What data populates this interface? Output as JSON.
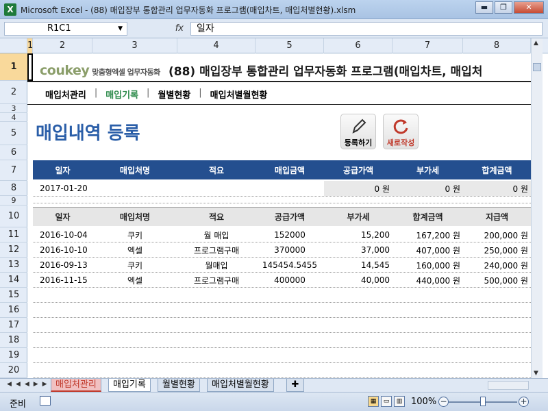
{
  "window": {
    "title": "Microsoft Excel - (88) 매입장부 통합관리 업무자동화 프로그램(매입차트, 매입처별현황).xlsm",
    "min": "▬",
    "max": "❐",
    "close": "✕"
  },
  "formula": {
    "namebox": "R1C1",
    "fx": "fx",
    "value": "일자"
  },
  "columns": [
    "1",
    "2",
    "3",
    "4",
    "5",
    "6",
    "7",
    "8"
  ],
  "rows": [
    "1",
    "2",
    "3",
    "4",
    "5",
    "6",
    "7",
    "8",
    "9",
    "10",
    "11",
    "12",
    "13",
    "14",
    "15",
    "16",
    "17",
    "18",
    "19",
    "20"
  ],
  "logo": {
    "brand": "coukey",
    "sub": "맞춤형엑셀 업무자동화"
  },
  "bigtitle": "(88) 매입장부 통합관리 업무자동화 프로그램(매입차트, 매입처",
  "nav": [
    "매입처관리",
    "매입기록",
    "월별현황",
    "매입처별월현황"
  ],
  "pagetitle": "매입내역 등록",
  "buttons": {
    "register": "등록하기",
    "new": "새로작성"
  },
  "input_header": [
    "일자",
    "매입처명",
    "적요",
    "매입금액",
    "공급가액",
    "부가세",
    "합계금액"
  ],
  "input_row": {
    "date": "2017-01-20",
    "supply": "0 원",
    "vat": "0 원",
    "total": "0 원"
  },
  "list_header": [
    "일자",
    "매입처명",
    "적요",
    "공급가액",
    "부가세",
    "합계금액",
    "지급액"
  ],
  "list_rows": [
    [
      "2016-10-04",
      "쿠키",
      "월 매입",
      "152000",
      "15,200",
      "167,200 원",
      "200,000 원"
    ],
    [
      "2016-10-10",
      "엑셀",
      "프로그램구매",
      "370000",
      "37,000",
      "407,000 원",
      "250,000 원"
    ],
    [
      "2016-09-13",
      "쿠키",
      "월매입",
      "145454.5455",
      "14,545",
      "160,000 원",
      "240,000 원"
    ],
    [
      "2016-11-15",
      "엑셀",
      "프로그램구매",
      "400000",
      "40,000",
      "440,000 원",
      "500,000 원"
    ]
  ],
  "tabs": [
    "매입처관리",
    "매입기록",
    "월별현황",
    "매입처별월현황"
  ],
  "status": {
    "ready": "준비",
    "zoom": "100%"
  },
  "colors": {
    "header_blue": "#244f8f",
    "title_blue": "#2a5ea8",
    "nav_active": "#2c8a4a"
  }
}
